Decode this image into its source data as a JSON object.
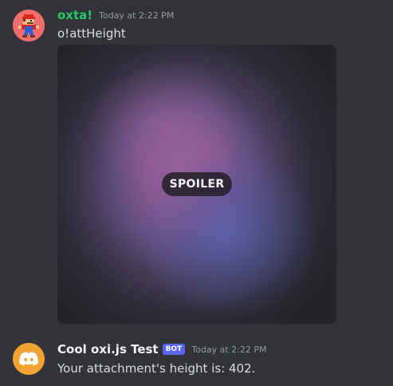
{
  "messages": [
    {
      "author": "oxta!",
      "timestamp": "Today at 2:22 PM",
      "text": "o!attHeight",
      "attachment": {
        "spoiler_label": "SPOILER"
      },
      "avatar_icon": "pixel-mario-avatar"
    },
    {
      "author": "Cool oxi.js Test",
      "badge": "BOT",
      "timestamp": "Today at 2:22 PM",
      "text": "Your attachment's height is: 402.",
      "avatar_icon": "discord-logo-avatar"
    }
  ],
  "colors": {
    "background": "#313338",
    "user_name": "#27c86b",
    "bot_badge": "#5865f2",
    "text": "#dbdee1",
    "timestamp": "#949ba4"
  }
}
